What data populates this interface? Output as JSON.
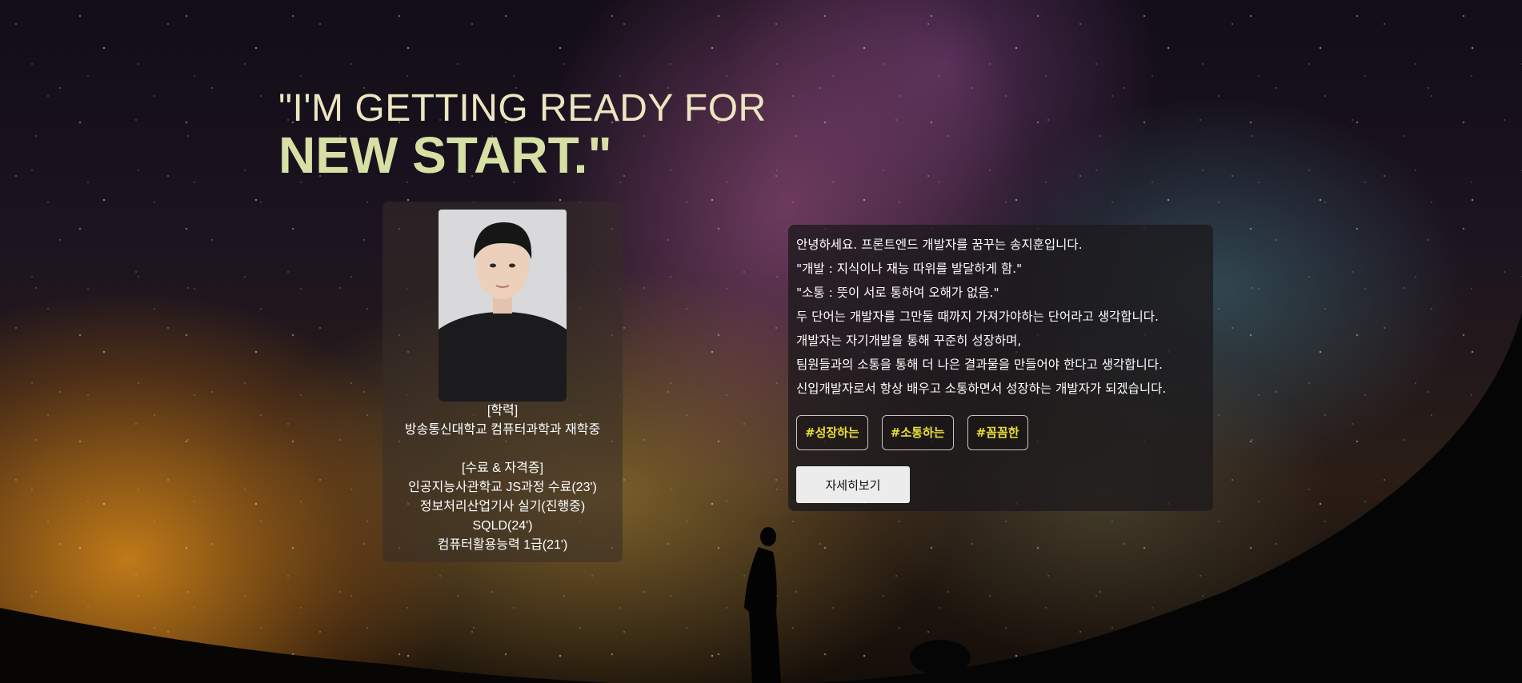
{
  "hero": {
    "headline_line1": "\"I'M GETTING READY FOR",
    "headline_line2": "NEW START.\""
  },
  "profile": {
    "education_heading": "[학력]",
    "education": "방송통신대학교 컴퓨터과학과 재학중",
    "certs_heading": "[수료 & 자격증]",
    "certs": [
      "인공지능사관학교 JS과정 수료(23')",
      "정보처리산업기사 실기(진행중)",
      "SQLD(24')",
      "컴퓨터활용능력 1급(21')"
    ]
  },
  "intro": {
    "lines": [
      "안녕하세요. 프론트엔드 개발자를 꿈꾸는 송지훈입니다.",
      "\"개발 : 지식이나 재능 따위를 발달하게 함.\"",
      "\"소통 : 뜻이 서로 통하여 오해가 없음.\"",
      "두 단어는 개발자를 그만둘 때까지 가져가야하는 단어라고 생각합니다.",
      "개발자는 자기개발을 통해 꾸준히 성장하며,",
      "팀원들과의 소통을 통해 더 나은 결과물을 만들어야 한다고 생각합니다.",
      "신입개발자로서 항상 배우고 소통하면서 성장하는 개발자가 되겠습니다."
    ],
    "tags": [
      "#성장하는",
      "#소통하는",
      "#꼼꼼한"
    ],
    "more_button": "자세히보기"
  },
  "colors": {
    "headline": "#d6e0a4",
    "tag_text": "#e9df3a",
    "button_bg": "#ececec"
  }
}
